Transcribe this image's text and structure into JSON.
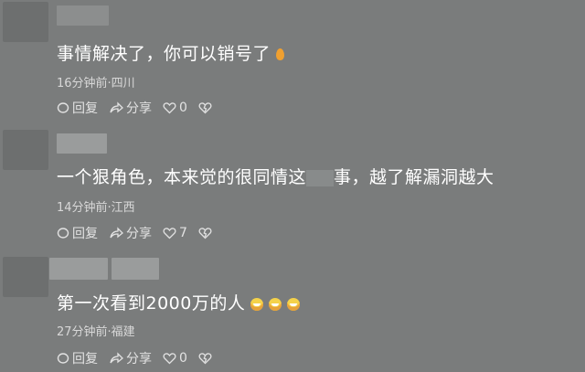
{
  "comments": [
    {
      "text": "事情解决了，你可以销号了",
      "meta": "16分钟前·四川",
      "reply_label": "回复",
      "share_label": "分享",
      "like_count": "0"
    },
    {
      "text_a": "一个狠角色，本来觉的很同情这",
      "text_b": "事，越了解漏洞越大",
      "meta": "14分钟前·江西",
      "reply_label": "回复",
      "share_label": "分享",
      "like_count": "7"
    },
    {
      "text": "第一次看到2000万的人",
      "meta": "27分钟前·福建",
      "reply_label": "回复",
      "share_label": "分享",
      "like_count": "0"
    }
  ],
  "icons": [
    "reply-icon",
    "share-icon",
    "like-icon",
    "dislike-icon",
    "fire-emoji-icon",
    "laugh-emoji-icon"
  ]
}
